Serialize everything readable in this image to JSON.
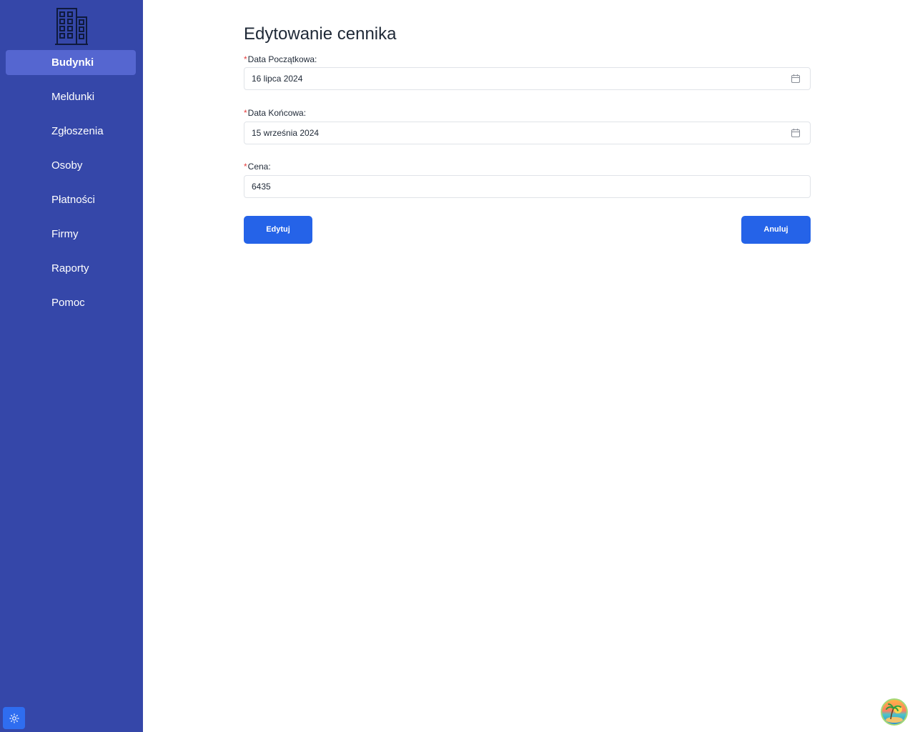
{
  "sidebar": {
    "items": [
      {
        "label": "Budynki"
      },
      {
        "label": "Meldunki"
      },
      {
        "label": "Zgłoszenia"
      },
      {
        "label": "Osoby"
      },
      {
        "label": "Płatności"
      },
      {
        "label": "Firmy"
      },
      {
        "label": "Raporty"
      },
      {
        "label": "Pomoc"
      }
    ],
    "active_index": 0
  },
  "form": {
    "title": "Edytowanie cennika",
    "required_mark": "*",
    "start_date": {
      "label": "Data Początkowa:",
      "value": "16 lipca 2024",
      "icon": "calendar-icon"
    },
    "end_date": {
      "label": "Data Końcowa:",
      "value": "15 września 2024",
      "icon": "calendar-icon"
    },
    "price": {
      "label": "Cena:",
      "value": "6435"
    },
    "submit_label": "Edytuj",
    "cancel_label": "Anuluj"
  },
  "colors": {
    "sidebar_bg": "#3547a9",
    "sidebar_active": "#5566d0",
    "primary": "#2563e8",
    "required": "#e53e3e"
  },
  "icons": {
    "logo": "building-icon",
    "theme_toggle": "sun-icon",
    "avatar": "avatar"
  }
}
